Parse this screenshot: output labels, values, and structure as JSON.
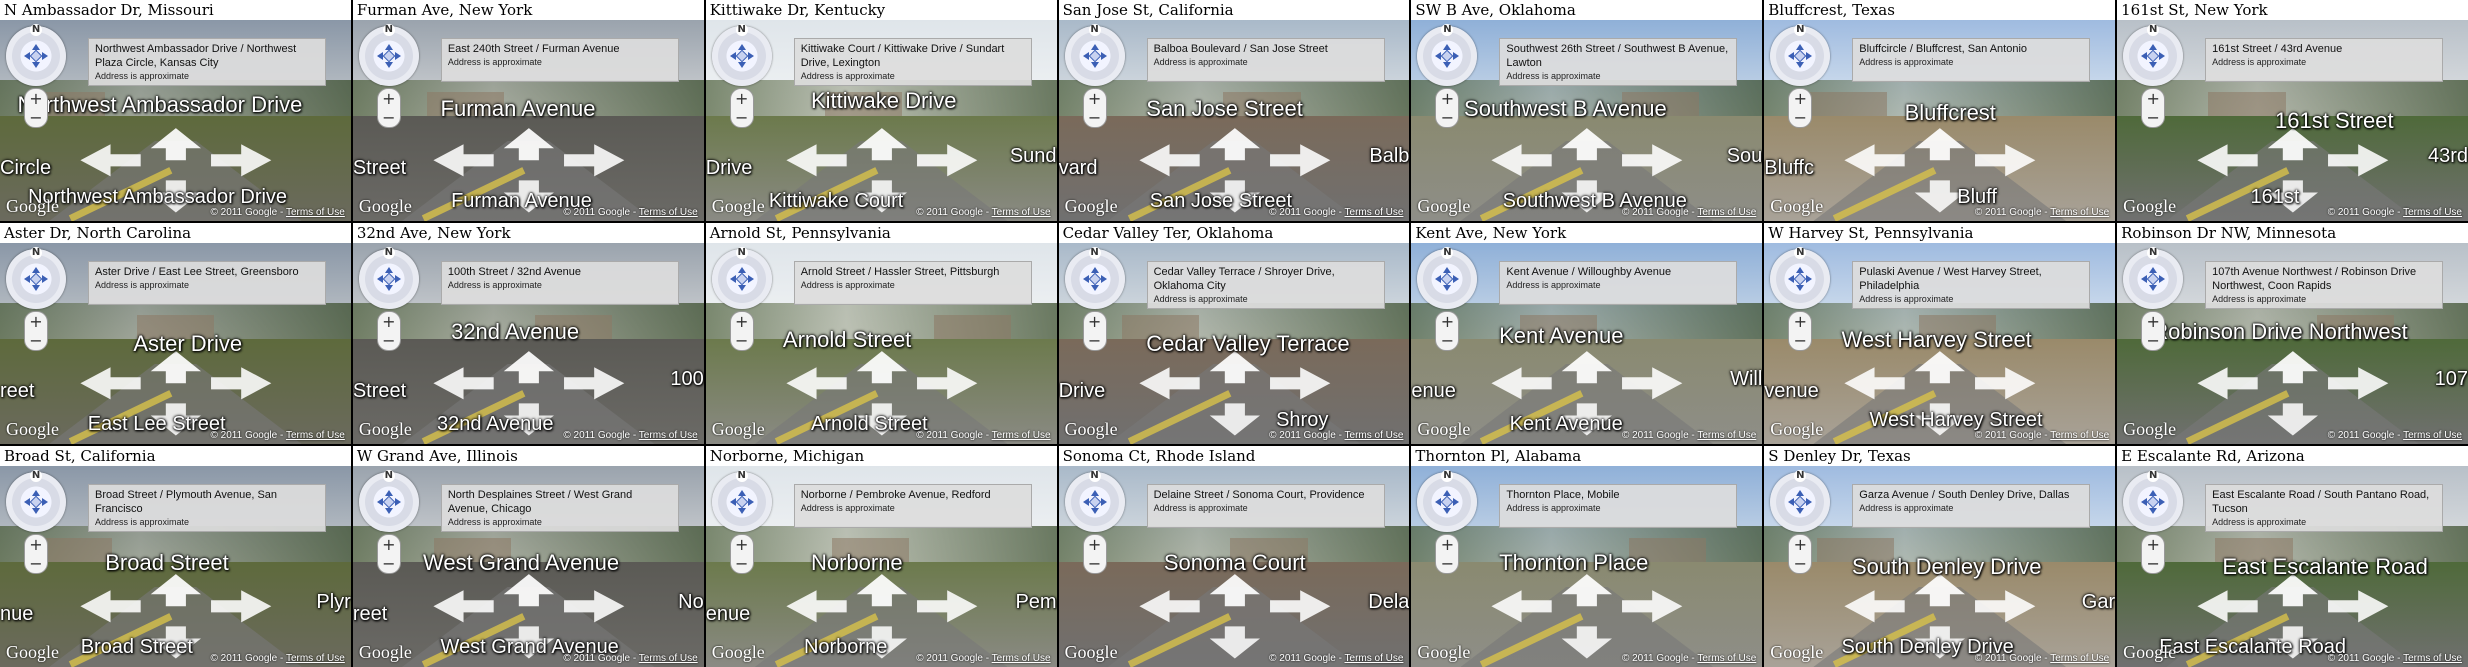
{
  "common": {
    "address_note": "Address is approximate",
    "google_logo": "Google",
    "copyright": "© 2011 Google -",
    "terms_link": "Terms of Use",
    "compass_north": "N",
    "zoom_in": "+",
    "zoom_out": "−"
  },
  "panoramas": [
    {
      "caption": "N Ambassador Dr, Missouri",
      "address": "Northwest Ambassador Drive / Northwest Plaza Circle, Kansas City",
      "main_label": "Northwest Ambassador Drive",
      "lower_label": "Northwest Ambassador Drive",
      "side_left": "Circle",
      "side_right": ""
    },
    {
      "caption": "Furman Ave, New York",
      "address": "East 240th Street / Furman Avenue",
      "main_label": "Furman Avenue",
      "lower_label": "Furman Avenue",
      "side_left": "Street",
      "side_right": ""
    },
    {
      "caption": "Kittiwake Dr, Kentucky",
      "address": "Kittiwake Court / Kittiwake Drive / Sundart Drive, Lexington",
      "main_label": "Kittiwake Drive",
      "lower_label": "Kittiwake Court",
      "side_left": "Drive",
      "side_right": "Sund"
    },
    {
      "caption": "San Jose St, California",
      "address": "Balboa Boulevard / San Jose Street",
      "main_label": "San Jose Street",
      "lower_label": "San Jose Street",
      "side_left": "vard",
      "side_right": "Balb"
    },
    {
      "caption": "SW B Ave, Oklahoma",
      "address": "Southwest 26th Street / Southwest B Avenue, Lawton",
      "main_label": "Southwest B Avenue",
      "lower_label": "Southwest B Avenue",
      "side_left": "",
      "side_right": "Sou"
    },
    {
      "caption": "Bluffcrest, Texas",
      "address": "Bluffcircle / Bluffcrest, San Antonio",
      "main_label": "Bluffcrest",
      "lower_label": "Bluff",
      "side_left": "Bluffc",
      "side_right": ""
    },
    {
      "caption": "161st St, New York",
      "address": "161st Street / 43rd Avenue",
      "main_label": "161st Street",
      "lower_label": "161st",
      "side_left": "",
      "side_right": "43rd"
    },
    {
      "caption": "Aster Dr, North Carolina",
      "address": "Aster Drive / East Lee Street, Greensboro",
      "main_label": "Aster Drive",
      "lower_label": "East Lee Street",
      "side_left": "reet",
      "side_right": ""
    },
    {
      "caption": "32nd Ave, New York",
      "address": "100th Street / 32nd Avenue",
      "main_label": "32nd Avenue",
      "lower_label": "32nd Avenue",
      "side_left": "Street",
      "side_right": "100"
    },
    {
      "caption": "Arnold St, Pennsylvania",
      "address": "Arnold Street / Hassler Street, Pittsburgh",
      "main_label": "Arnold Street",
      "lower_label": "Arnold Street",
      "side_left": "",
      "side_right": ""
    },
    {
      "caption": "Cedar Valley Ter, Oklahoma",
      "address": "Cedar Valley Terrace / Shroyer Drive, Oklahoma City",
      "main_label": "Cedar Valley Terrace",
      "lower_label": "Shroy",
      "side_left": "Drive",
      "side_right": ""
    },
    {
      "caption": "Kent Ave, New York",
      "address": "Kent Avenue / Willoughby Avenue",
      "main_label": "Kent Avenue",
      "lower_label": "Kent Avenue",
      "side_left": "enue",
      "side_right": "Will"
    },
    {
      "caption": "W Harvey St, Pennsylvania",
      "address": "Pulaski Avenue / West Harvey Street, Philadelphia",
      "main_label": "West Harvey Street",
      "lower_label": "West Harvey Street",
      "side_left": "venue",
      "side_right": ""
    },
    {
      "caption": "Robinson Dr NW, Minnesota",
      "address": "107th Avenue Northwest / Robinson Drive Northwest, Coon Rapids",
      "main_label": "Robinson Drive Northwest",
      "lower_label": "",
      "side_left": "",
      "side_right": "107"
    },
    {
      "caption": "Broad St, California",
      "address": "Broad Street / Plymouth Avenue, San Francisco",
      "main_label": "Broad Street",
      "lower_label": "Broad Street",
      "side_left": "nue",
      "side_right": "Plyr"
    },
    {
      "caption": "W Grand Ave, Illinois",
      "address": "North Desplaines Street / West Grand Avenue, Chicago",
      "main_label": "West Grand Avenue",
      "lower_label": "West Grand Avenue",
      "side_left": "reet",
      "side_right": "No"
    },
    {
      "caption": "Norborne, Michigan",
      "address": "Norborne / Pembroke Avenue, Redford",
      "main_label": "Norborne",
      "lower_label": "Norborne",
      "side_left": "enue",
      "side_right": "Pem"
    },
    {
      "caption": "Sonoma Ct, Rhode Island",
      "address": "Delaine Street / Sonoma Court, Providence",
      "main_label": "Sonoma Court",
      "lower_label": "",
      "side_left": "",
      "side_right": "Dela"
    },
    {
      "caption": "Thornton Pl, Alabama",
      "address": "Thornton Place, Mobile",
      "main_label": "Thornton Place",
      "lower_label": "",
      "side_left": "",
      "side_right": ""
    },
    {
      "caption": "S Denley Dr, Texas",
      "address": "Garza Avenue / South Denley Drive, Dallas",
      "main_label": "South Denley Drive",
      "lower_label": "South Denley Drive",
      "side_left": "",
      "side_right": "Gar"
    },
    {
      "caption": "E Escalante Rd, Arizona",
      "address": "East Escalante Road / South Pantano Road, Tucson",
      "main_label": "East Escalante Road",
      "lower_label": "East Escalante Road",
      "side_left": "",
      "side_right": ""
    }
  ],
  "colors": {
    "sky_overcast": "#c9ccd0",
    "sky_blue": "#9fb6d8",
    "grass": "#4f6b35",
    "asphalt": "#6e6e6a",
    "arrow_fill": "#ffffff",
    "road_line": "#d8c24a"
  }
}
